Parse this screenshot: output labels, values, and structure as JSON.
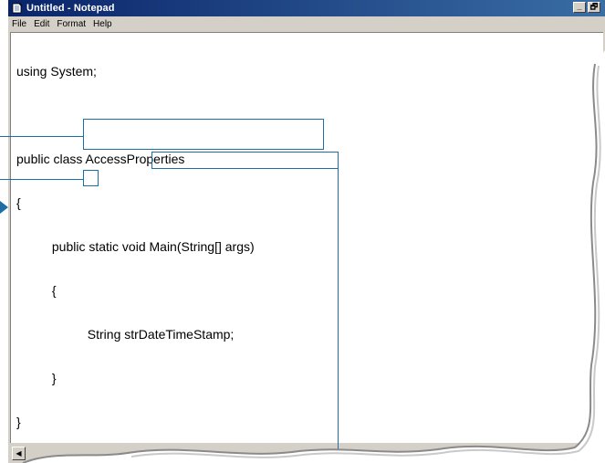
{
  "window": {
    "title": "Untitled - Notepad",
    "icon": "notepad-icon",
    "buttons": {
      "minimize": "_",
      "maximize": "🗗"
    }
  },
  "menu": [
    "File",
    "Edit",
    "Format",
    "Help"
  ],
  "editor": {
    "lines": [
      "using System;",
      "",
      "public class AccessProperties",
      "{",
      "          public static void Main(String[] args)",
      "          {",
      "                    String strDateTimeStamp;",
      "          }",
      "}"
    ]
  },
  "scrollbar": {
    "left_arrow": "◀"
  },
  "colors": {
    "accent": "#1d6ea5",
    "titlebar_start": "#0a246a",
    "titlebar_end": "#3a6ea5",
    "chrome": "#d4d0c8"
  }
}
